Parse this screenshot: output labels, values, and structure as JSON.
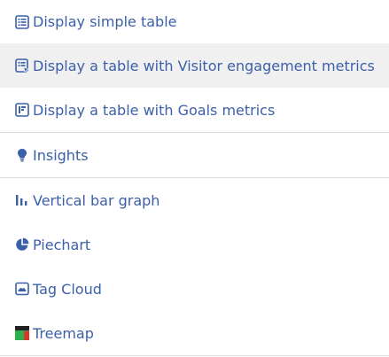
{
  "menu": {
    "items": [
      {
        "label": "Display simple table",
        "icon": "table-list-icon"
      },
      {
        "label": "Display a table with Visitor engagement metrics",
        "icon": "table-engagement-icon"
      },
      {
        "label": "Display a table with Goals metrics",
        "icon": "table-goals-icon"
      },
      {
        "label": "Insights",
        "icon": "lightbulb-icon"
      },
      {
        "label": "Vertical bar graph",
        "icon": "bar-chart-icon"
      },
      {
        "label": "Piechart",
        "icon": "pie-chart-icon"
      },
      {
        "label": "Tag Cloud",
        "icon": "tag-cloud-icon"
      },
      {
        "label": "Treemap",
        "icon": "treemap-icon"
      }
    ]
  },
  "colors": {
    "link": "#3b5fa8",
    "highlight_bg": "#f0f0f0",
    "divider": "#dcdcdc",
    "treemap_green": "#2bb24c",
    "treemap_dark": "#222222",
    "treemap_red": "#d9372c",
    "treemap_gray": "#777777"
  }
}
